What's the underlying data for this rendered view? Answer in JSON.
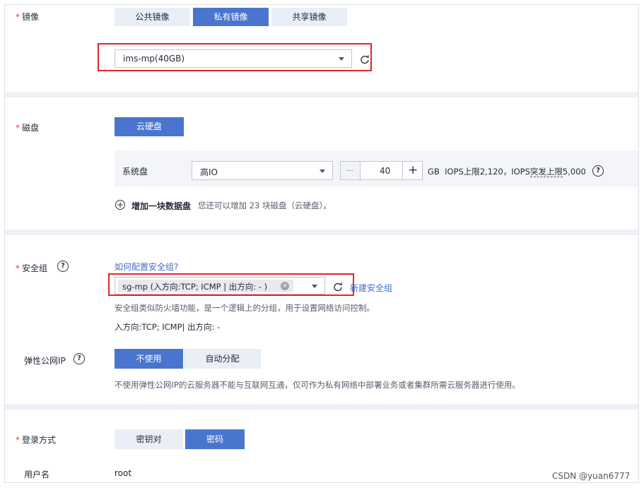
{
  "image_section": {
    "label": "镜像",
    "tabs": [
      {
        "label": "公共镜像",
        "active": false
      },
      {
        "label": "私有镜像",
        "active": true
      },
      {
        "label": "共享镜像",
        "active": false
      }
    ],
    "selected_image": "ims-mp(40GB)"
  },
  "disk_section": {
    "label": "磁盘",
    "disk_type_button": "云硬盘",
    "system_disk_label": "系统盘",
    "system_disk_type": "高IO",
    "size_value": "40",
    "size_unit": "GB",
    "iops_text": "IOPS上限2,120，IOPS",
    "iops_burst": "突发上限",
    "iops_burst_value": "5,000",
    "add_disk_label": "增加一块数据盘",
    "add_disk_hint": "您还可以增加 23 块磁盘（云硬盘）。"
  },
  "security_section": {
    "label": "安全组",
    "config_link": "如何配置安全组?",
    "selected_group": "sg-mp (入方向:TCP; ICMP | 出方向: - )",
    "new_group_link": "新建安全组",
    "description": "安全组类似防火墙功能，是一个逻辑上的分组，用于设置网络访问控制。",
    "rules_summary": "入方向:TCP; ICMP| 出方向: -"
  },
  "eip_section": {
    "label": "弹性公网IP",
    "options": [
      {
        "label": "不使用",
        "active": true
      },
      {
        "label": "自动分配",
        "active": false
      }
    ],
    "note": "不使用弹性公网IP的云服务器不能与互联网互通，仅可作为私有网络中部署业务或者集群所需云服务器进行使用。"
  },
  "login_section": {
    "label": "登录方式",
    "options": [
      {
        "label": "密钥对",
        "active": false
      },
      {
        "label": "密码",
        "active": true
      }
    ],
    "username_label": "用户名",
    "username_value": "root"
  },
  "watermark": "CSDN @yuan6777",
  "colors": {
    "primary": "#4a75cf",
    "required_star": "#e0433a",
    "highlight_box": "#e0262a",
    "separator": "#eef0f5"
  }
}
